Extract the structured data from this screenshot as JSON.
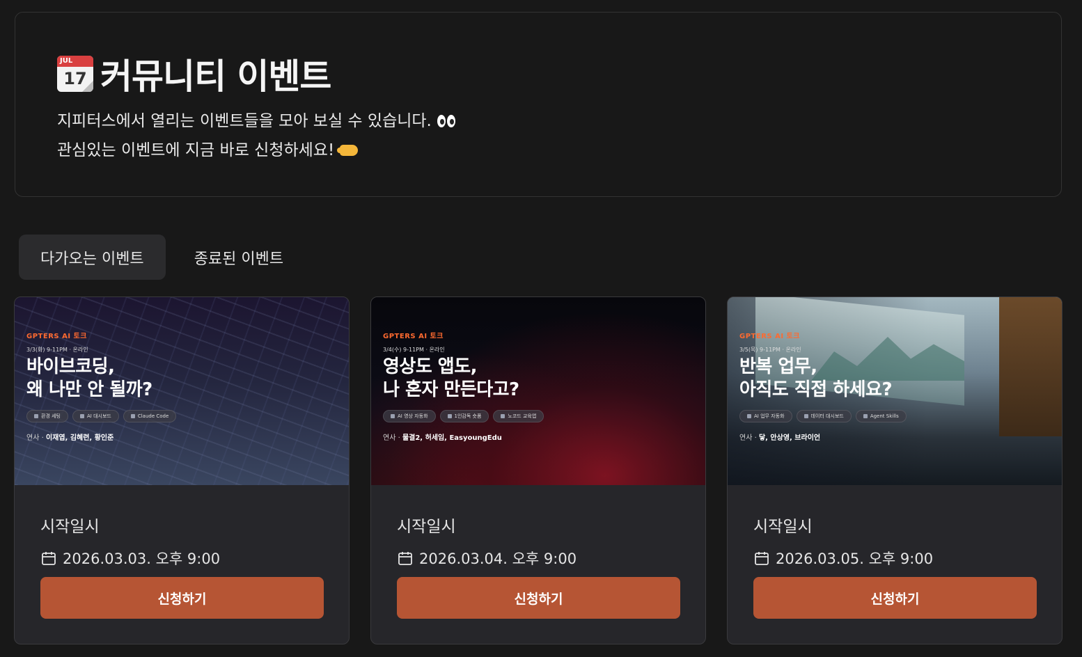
{
  "hero": {
    "title": "커뮤니티 이벤트",
    "calendar_emoji": {
      "month": "JUL",
      "day": "17"
    },
    "desc_line1": "지피터스에서 열리는 이벤트들을 모아 보실 수 있습니다.",
    "desc_line2": "관심있는 이벤트에 지금 바로 신청하세요!",
    "emoji1": "eyes",
    "emoji2": "pointing-hand"
  },
  "tabs": [
    {
      "label": "다가오는 이벤트",
      "active": true
    },
    {
      "label": "종료된 이벤트",
      "active": false
    }
  ],
  "accent_color": "#b65534",
  "cards": [
    {
      "banner": {
        "tag": "GPTERS AI 토크",
        "meta": "3/3(화) 9-11PM · 온라인",
        "title_line1": "바이브코딩,",
        "title_line2": "왜 나만 안 될까?",
        "pills": [
          "환경 세팅",
          "AI 대시보드",
          "Claude Code"
        ],
        "speakers_prefix": "연사 · ",
        "speakers": "이재엽, 김혜련, 황인준"
      },
      "start_label": "시작일시",
      "date": "2026.03.03. 오후 9:00",
      "button": "신청하기"
    },
    {
      "banner": {
        "tag": "GPTERS AI 토크",
        "meta": "3/4(수) 9-11PM · 온라인",
        "title_line1": "영상도 앱도,",
        "title_line2": "나 혼자 만든다고?",
        "pills": [
          "AI 영상 자동화",
          "1인감독 숏폼",
          "노코드 교육앱"
        ],
        "speakers_prefix": "연사 · ",
        "speakers": "물결2, 허세임, EasyoungEdu"
      },
      "start_label": "시작일시",
      "date": "2026.03.04. 오후 9:00",
      "button": "신청하기"
    },
    {
      "banner": {
        "tag": "GPTERS AI 토크",
        "meta": "3/5(목) 9-11PM · 온라인",
        "title_line1": "반복 업무,",
        "title_line2": "아직도 직접 하세요?",
        "pills": [
          "AI 업무 자동화",
          "데이터 대시보드",
          "Agent Skills"
        ],
        "speakers_prefix": "연사 · ",
        "speakers": "닿, 안상영, 브라이언"
      },
      "start_label": "시작일시",
      "date": "2026.03.05. 오후 9:00",
      "button": "신청하기"
    }
  ]
}
